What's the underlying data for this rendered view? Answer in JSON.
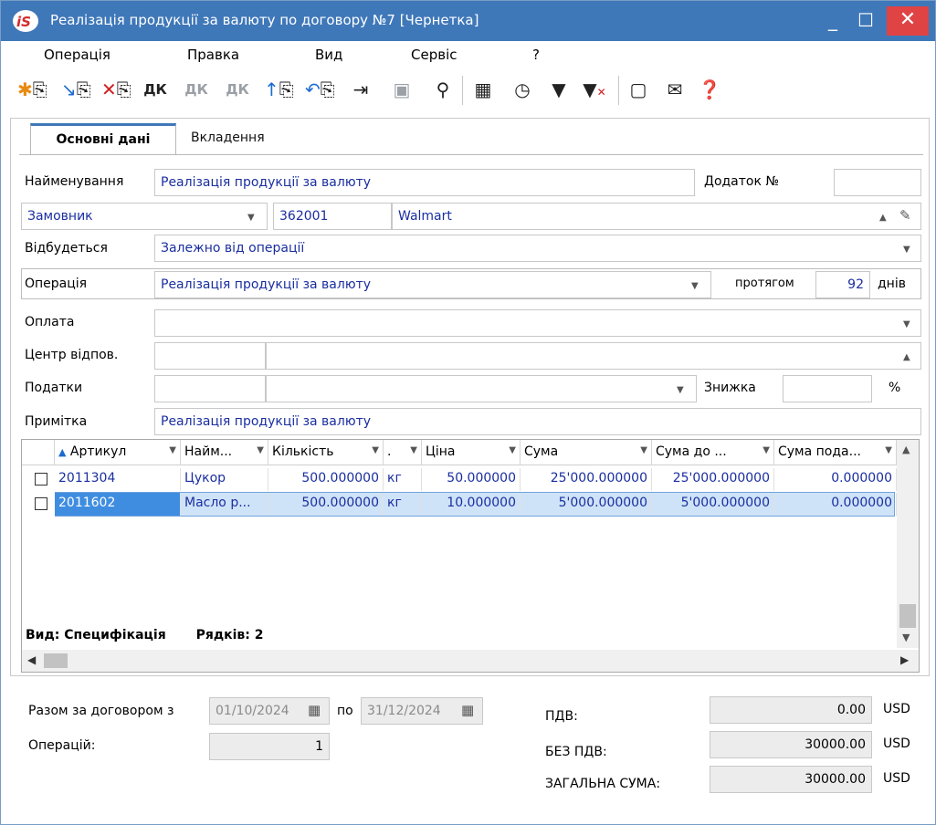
{
  "window": {
    "title": "Реалізація продукції за валюту по договору №7 [Чернетка]",
    "min_glyph": "_",
    "max_glyph": "☐",
    "close_glyph": "✕"
  },
  "menu": [
    "Операція",
    "Правка",
    "Вид",
    "Сервіс",
    "?"
  ],
  "toolbar": {
    "dk": "ДК"
  },
  "tabs": [
    "Основні дані",
    "Вкладення"
  ],
  "form": {
    "name_label": "Найменування",
    "name_value": "Реалізація продукції за валюту",
    "addendum_label": "Додаток №",
    "addendum_value": "",
    "party_role": "Замовник",
    "party_code": "362001",
    "party_name": "Walmart",
    "happens_label": "Відбудеться",
    "happens_value": "Залежно від операції",
    "operation_label": "Операція",
    "operation_value": "Реалізація продукції за валюту",
    "within_label": "протягом",
    "within_value": "92",
    "days_label": "днів",
    "payment_label": "Оплата",
    "payment_value": "",
    "center_label": "Центр відпов.",
    "taxes_label": "Податки",
    "discount_label": "Знижка",
    "discount_value": "",
    "percent": "%",
    "note_label": "Примітка",
    "note_value": "Реалізація продукції за валюту"
  },
  "grid": {
    "columns": [
      "Артикул",
      "Найм...",
      "Кількість",
      ".",
      "Ціна",
      "Сума",
      "Сума до ...",
      "Сума пода..."
    ],
    "rows": [
      [
        "2011304",
        "Цукор",
        "500.000000",
        "кг",
        "50.000000",
        "25'000.000000",
        "25'000.000000",
        "0.000000"
      ],
      [
        "2011602",
        "Масло р...",
        "500.000000",
        "кг",
        "10.000000",
        "5'000.000000",
        "5'000.000000",
        "0.000000"
      ]
    ],
    "view_label": "Вид: Специфікація",
    "rows_label": "Рядків: 2"
  },
  "totals": {
    "period_label": "Разом за договором з",
    "date_from": "01/10/2024",
    "to_label": "по",
    "date_to": "31/12/2024",
    "ops_label": "Операцій:",
    "ops_value": "1",
    "vat_label": "ПДВ:",
    "vat_value": "0.00",
    "novat_label": "БЕЗ ПДВ:",
    "novat_value": "30000.00",
    "total_label": "ЗАГАЛЬНА СУМА:",
    "total_value": "30000.00",
    "currency": "USD"
  }
}
